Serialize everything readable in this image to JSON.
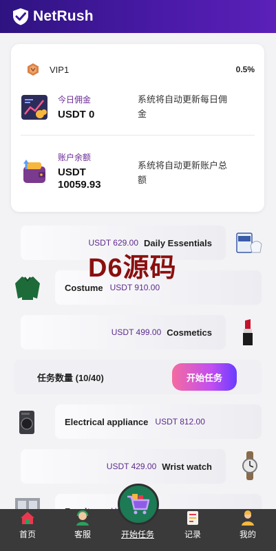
{
  "app": {
    "brand": "NetRush"
  },
  "account": {
    "vip_level": "VIP1",
    "commission_rate": "0.5%",
    "today_commission": {
      "title": "今日佣金",
      "value": "USDT 0",
      "note": "系统将自动更新每日佣金"
    },
    "balance": {
      "title": "账户余额",
      "value": "USDT 10059.93",
      "note": "系统将自动更新账户总额"
    }
  },
  "watermark": "D6源码",
  "products": [
    {
      "name": "Daily Essentials",
      "price": "USDT 629.00",
      "icon": "gloves-box-icon"
    },
    {
      "name": "Costume",
      "price": "USDT 910.00",
      "icon": "sweater-icon"
    },
    {
      "name": "Cosmetics",
      "price": "USDT 499.00",
      "icon": "lipstick-icon"
    },
    {
      "name": "Electrical appliance",
      "price": "USDT 812.00",
      "icon": "washing-machine-icon"
    },
    {
      "name": "Wrist watch",
      "price": "USDT 429.00",
      "icon": "wrist-watch-icon"
    },
    {
      "name": "Furniture",
      "price": "USDT",
      "icon": "furniture-icon"
    }
  ],
  "task": {
    "count_label": "任务数量 (10/40)",
    "start_label": "开始任务"
  },
  "tabbar": {
    "items": [
      {
        "label": "首页",
        "icon": "home-icon"
      },
      {
        "label": "客服",
        "icon": "support-agent-icon"
      },
      {
        "label": "开始任务",
        "icon": "shopping-cart-icon"
      },
      {
        "label": "记录",
        "icon": "records-icon"
      },
      {
        "label": "我的",
        "icon": "profile-icon"
      }
    ]
  }
}
